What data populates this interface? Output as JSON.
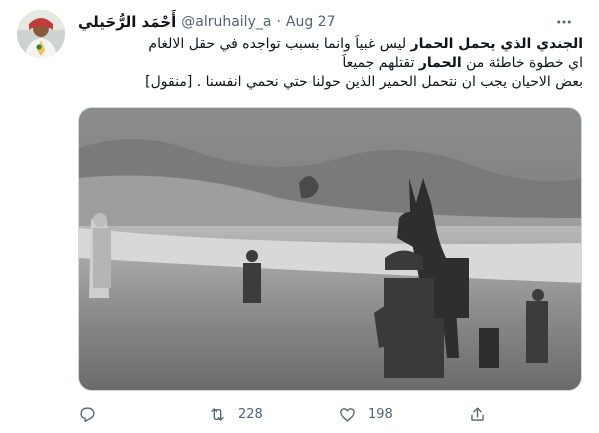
{
  "tweet": {
    "author": {
      "display_name": "أَحْمَد الرُّحَيلي",
      "handle": "@alruhaily_a",
      "separator": "·",
      "date": "Aug 27"
    },
    "text": {
      "line1_bold": "الجندي الذي يحمل الحمار",
      "line1_rest": " ليس غبياً وانما بسبب تواجده في حقل الالغام",
      "line2_a": "اي خطوة خاطئة من ",
      "line2_bold": "الحمار",
      "line2_b": " تقتلهم جميعاً",
      "line3": "بعض الاحيان يجب ان نتحمل الحمير الذين حولنا حتي نحمي انفسنا . [منقول]"
    },
    "actions": {
      "reply_icon": "reply-icon",
      "retweet_icon": "retweet-icon",
      "retweet_count": "228",
      "like_icon": "heart-icon",
      "like_count": "198",
      "share_icon": "share-icon"
    },
    "colors": {
      "text": "#0f1419",
      "secondary": "#536471",
      "border": "#cfd9de"
    }
  }
}
